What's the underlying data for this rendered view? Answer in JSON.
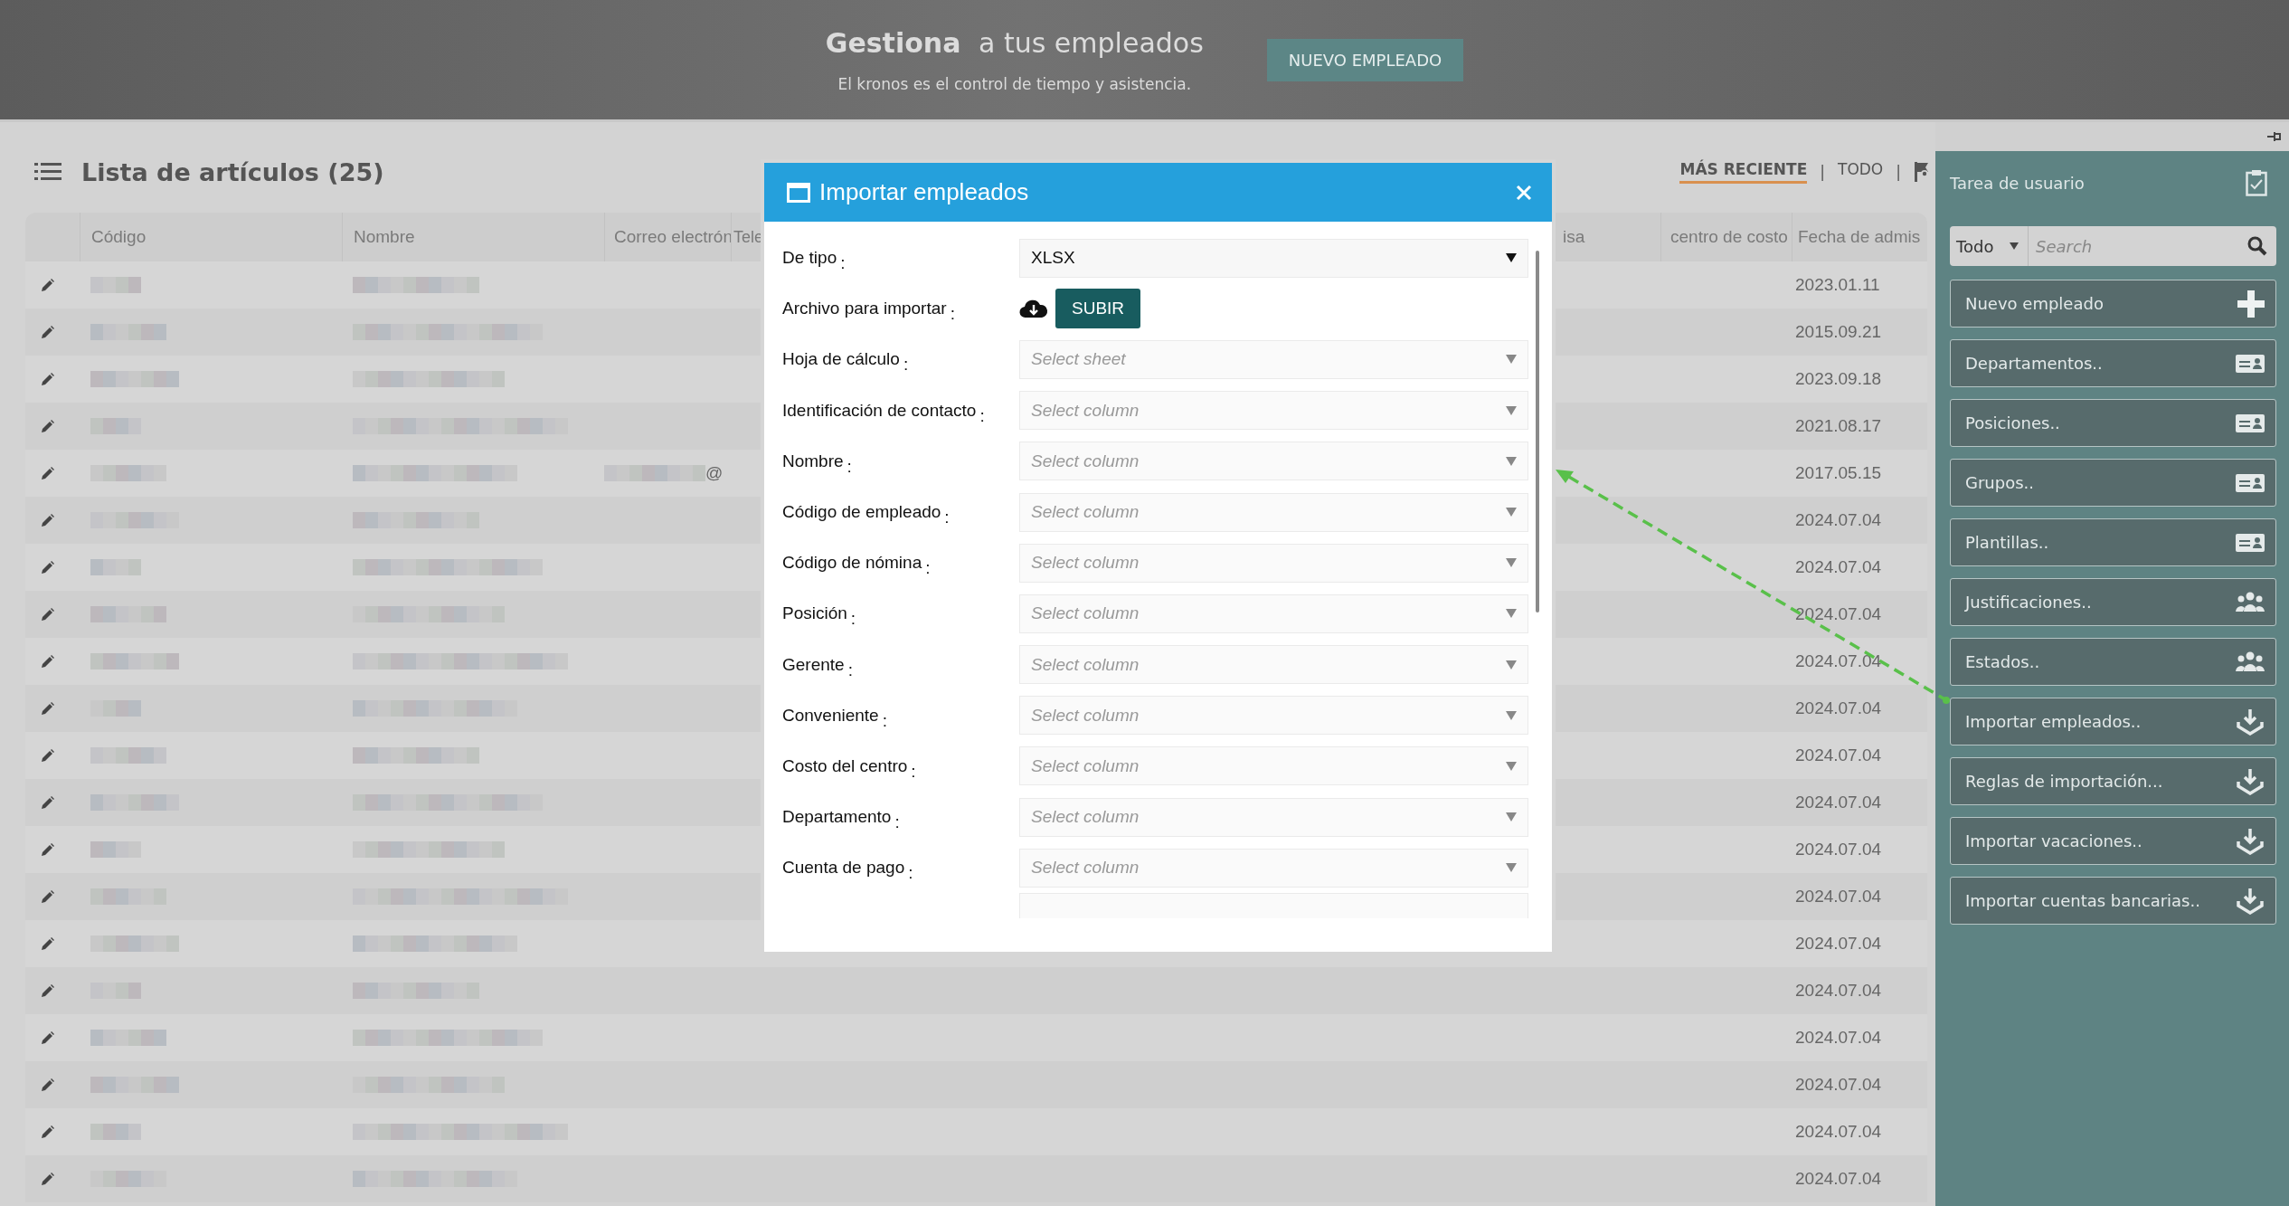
{
  "header": {
    "title_bold": "Gestiona",
    "title_rest": "a tus empleados",
    "subtitle": "El kronos es el control de tiempo y asistencia.",
    "button": "NUEVO EMPLEADO"
  },
  "list": {
    "title": "Lista de artículos (25)",
    "filters": [
      {
        "label": "MÁS RECIENTE",
        "selected": true
      },
      {
        "label": "TODO",
        "selected": false
      }
    ],
    "separators": [
      "|",
      "|"
    ],
    "columns": [
      "Código",
      "Nombre",
      "Correo electrón",
      "Tele",
      "isa",
      "centro de costo",
      "Fecha de admis"
    ],
    "rows": [
      {
        "date": "2023.01.11"
      },
      {
        "date": "2015.09.21"
      },
      {
        "date": "2023.09.18"
      },
      {
        "date": "2021.08.17"
      },
      {
        "date": "2017.05.15",
        "email_tail": "@"
      },
      {
        "date": "2024.07.04"
      },
      {
        "date": "2024.07.04"
      },
      {
        "date": "2024.07.04"
      },
      {
        "date": "2024.07.04"
      },
      {
        "date": "2024.07.04"
      },
      {
        "date": "2024.07.04"
      },
      {
        "date": "2024.07.04"
      },
      {
        "date": "2024.07.04"
      },
      {
        "date": "2024.07.04"
      },
      {
        "date": "2024.07.04"
      },
      {
        "date": "2024.07.04"
      },
      {
        "date": "2024.07.04"
      },
      {
        "date": "2024.07.04"
      },
      {
        "date": "2024.07.04"
      },
      {
        "date": "2024.07.04"
      }
    ]
  },
  "modal": {
    "title": "Importar empleados",
    "fields": [
      {
        "kind": "select",
        "label": "De tipo",
        "suffix": ":",
        "value": "XLSX"
      },
      {
        "kind": "upload",
        "label": "Archivo para importar",
        "suffix": ":",
        "button": "SUBIR"
      },
      {
        "kind": "select",
        "label": "Hoja de cálculo",
        "suffix": ":",
        "placeholder": "Select sheet"
      },
      {
        "kind": "select",
        "label": "Identificación de contacto",
        "suffix": ":",
        "placeholder": "Select column"
      },
      {
        "kind": "select",
        "label": "Nombre",
        "suffix": ":",
        "placeholder": "Select column"
      },
      {
        "kind": "select",
        "label": "Código de empleado",
        "suffix": ":",
        "placeholder": "Select column"
      },
      {
        "kind": "select",
        "label": "Código de nómina",
        "suffix": ":",
        "placeholder": "Select column"
      },
      {
        "kind": "select",
        "label": "Posición",
        "suffix": ":",
        "placeholder": "Select column"
      },
      {
        "kind": "select",
        "label": "Gerente",
        "suffix": ":",
        "placeholder": "Select column"
      },
      {
        "kind": "select",
        "label": "Conveniente",
        "suffix": ":",
        "placeholder": "Select column"
      },
      {
        "kind": "select",
        "label": "Costo del centro",
        "suffix": ":",
        "placeholder": "Select column"
      },
      {
        "kind": "select",
        "label": "Departamento",
        "suffix": ":",
        "placeholder": "Select column"
      },
      {
        "kind": "select",
        "label": "Cuenta de pago",
        "suffix": ":",
        "placeholder": "Select column"
      },
      {
        "kind": "select"
      }
    ]
  },
  "sidebar": {
    "title": "Tarea de usuario",
    "filter": "Todo",
    "search_placeholder": "Search",
    "actions": [
      {
        "label": "Nuevo empleado",
        "kind": "plus"
      },
      {
        "label": "Departamentos..",
        "kind": "card"
      },
      {
        "label": "Posiciones..",
        "kind": "card"
      },
      {
        "label": "Grupos..",
        "kind": "card"
      },
      {
        "label": "Plantillas..",
        "kind": "card"
      },
      {
        "label": "Justificaciones..",
        "kind": "people"
      },
      {
        "label": "Estados..",
        "kind": "people"
      },
      {
        "label": "Importar empleados..",
        "kind": "download"
      },
      {
        "label": "Reglas de importación...",
        "kind": "download"
      },
      {
        "label": "Importar vacaciones..",
        "kind": "download"
      },
      {
        "label": "Importar cuentas bancarias..",
        "kind": "download"
      }
    ]
  }
}
